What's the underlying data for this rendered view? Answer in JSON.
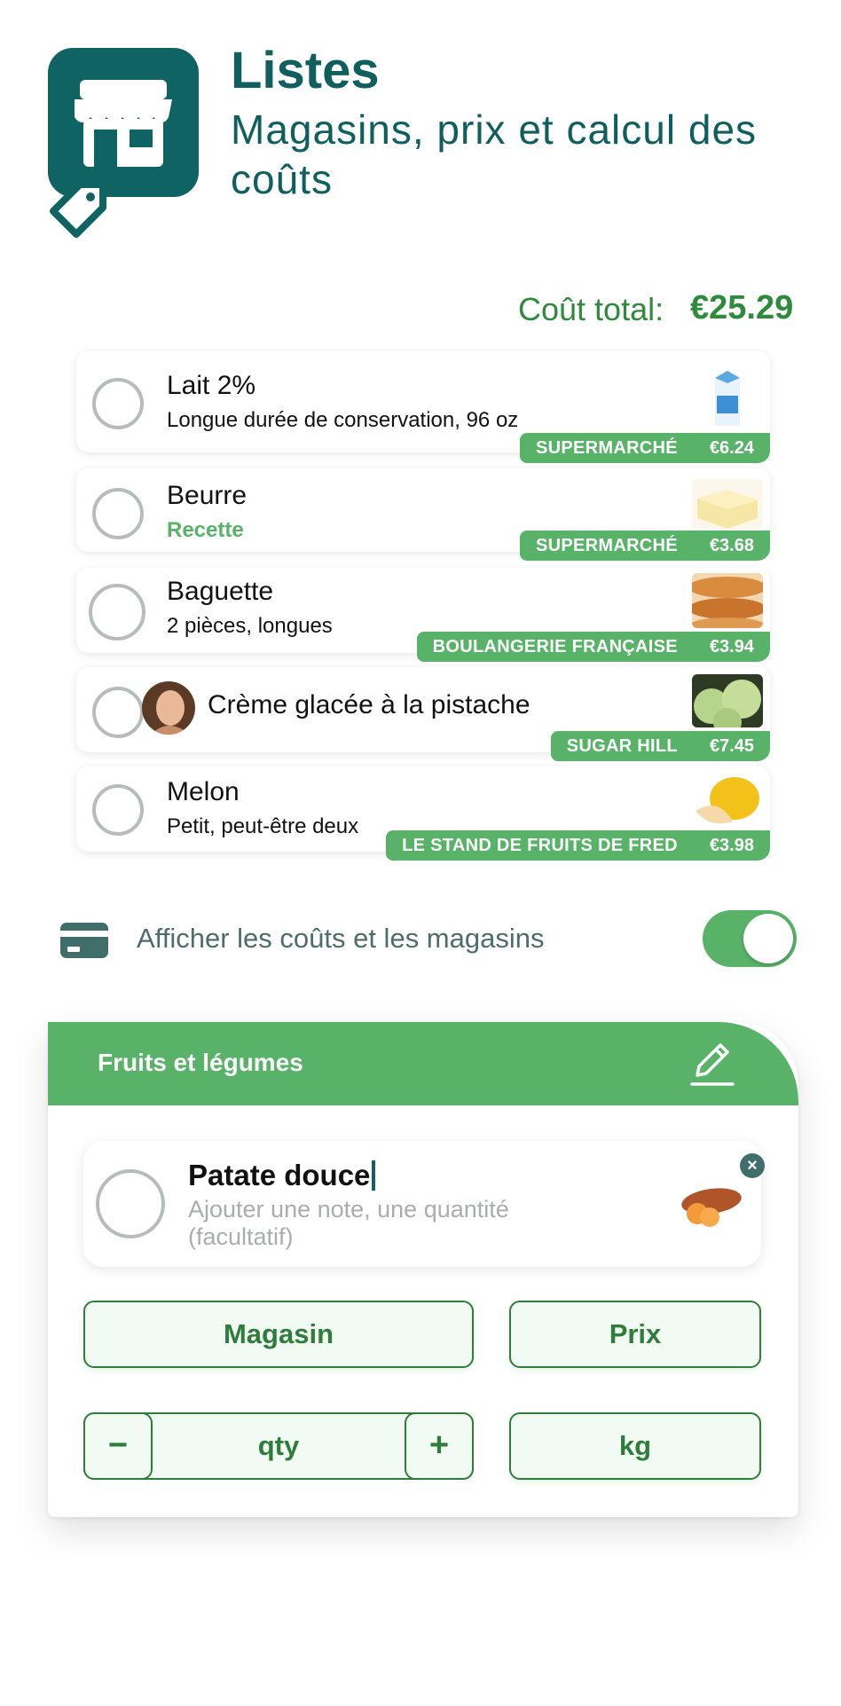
{
  "header": {
    "title": "Listes",
    "subtitle": "Magasins, prix et calcul des coûts"
  },
  "total": {
    "label": "Coût total:",
    "value": "€25.29"
  },
  "items": [
    {
      "name": "Lait 2%",
      "note": "Longue durée de conservation, 96 oz",
      "store": "SUPERMARCHÉ",
      "price": "€6.24",
      "thumb": "milk-carton-icon"
    },
    {
      "name": "Beurre",
      "note": "Recette",
      "store": "SUPERMARCHÉ",
      "price": "€3.68",
      "thumb": "butter-icon"
    },
    {
      "name": "Baguette",
      "note": "2 pièces, longues",
      "store": "BOULANGERIE FRANÇAISE",
      "price": "€3.94",
      "thumb": "baguette-icon"
    },
    {
      "name": "Crème glacée à la pistache",
      "note": "",
      "store": "SUGAR HILL",
      "price": "€7.45",
      "thumb": "pistachio-ice-cream-icon"
    },
    {
      "name": "Melon",
      "note": "Petit, peut-être deux",
      "store": "LE STAND DE FRUITS DE FRED",
      "price": "€3.98",
      "thumb": "melon-icon"
    }
  ],
  "toggle": {
    "label": "Afficher les coûts et les magasins",
    "on": true
  },
  "category": {
    "title": "Fruits et légumes",
    "edit_item": {
      "name": "Patate douce",
      "note_placeholder": "Ajouter une note, une quantité (facultatif)"
    },
    "store_button": "Magasin",
    "price_button": "Prix",
    "minus": "−",
    "qty": "qty",
    "plus": "+",
    "unit_button": "kg"
  },
  "colors": {
    "brand": "#0f6463",
    "accent": "#58b268",
    "text_green": "#2e7d3a"
  }
}
